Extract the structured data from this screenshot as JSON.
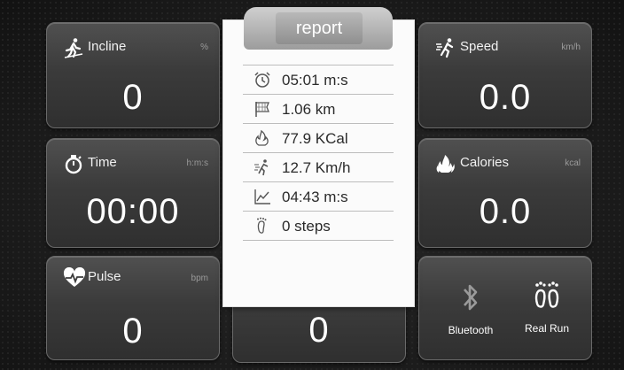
{
  "tiles": {
    "incline": {
      "label": "Incline",
      "unit": "%",
      "value": "0"
    },
    "speed": {
      "label": "Speed",
      "unit": "km/h",
      "value": "0.0"
    },
    "time": {
      "label": "Time",
      "unit": "h:m:s",
      "value": "00:00"
    },
    "calories": {
      "label": "Calories",
      "unit": "kcal",
      "value": "0.0"
    },
    "pulse": {
      "label": "Pulse",
      "unit": "bpm",
      "value": "0"
    },
    "center_bottom": {
      "value": "0"
    }
  },
  "report": {
    "title": "report",
    "rows": [
      {
        "icon": "alarm-clock-icon",
        "text": "05:01 m:s"
      },
      {
        "icon": "flag-icon",
        "text": "1.06 km"
      },
      {
        "icon": "flame-icon",
        "text": "77.9 KCal"
      },
      {
        "icon": "runner-icon",
        "text": "12.7 Km/h"
      },
      {
        "icon": "line-chart-icon",
        "text": "04:43 m:s"
      },
      {
        "icon": "footprint-icon",
        "text": "0 steps"
      }
    ]
  },
  "controls": {
    "bluetooth_label": "Bluetooth",
    "realrun_label": "Real Run"
  },
  "colors": {
    "tile_bg": "#3b3b3b",
    "tile_border": "#6a6a6a",
    "report_bg": "#fbfbfb",
    "text_light": "#ffffff"
  }
}
